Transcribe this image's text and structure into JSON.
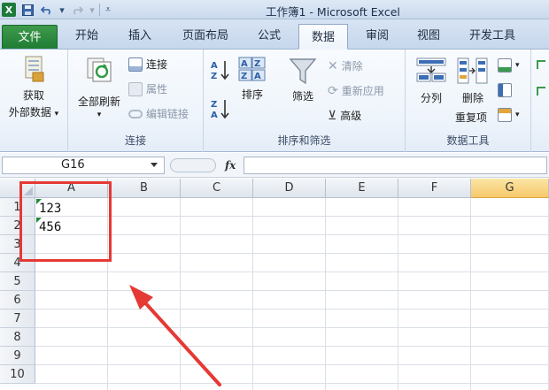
{
  "app": {
    "title": "工作簿1 - Microsoft Excel",
    "logo_letter": "X",
    "qat": {
      "save_icon": "save-icon",
      "undo_icon": "undo-icon",
      "redo_icon": "redo-icon",
      "customize_icon": "customize-qat-icon"
    }
  },
  "tabs": [
    {
      "label": "文件",
      "kind": "file"
    },
    {
      "label": "开始"
    },
    {
      "label": "插入"
    },
    {
      "label": "页面布局"
    },
    {
      "label": "公式"
    },
    {
      "label": "数据",
      "active": true
    },
    {
      "label": "审阅"
    },
    {
      "label": "视图"
    },
    {
      "label": "开发工具"
    }
  ],
  "ribbon": {
    "get_external_line1": "获取",
    "get_external_line2": "外部数据",
    "refresh_all": "全部刷新",
    "connections": "连接",
    "properties": "属性",
    "edit_links": "编辑链接",
    "group_connections": "连接",
    "sort": "排序",
    "filter": "筛选",
    "clear": "清除",
    "reapply": "重新应用",
    "advanced": "高级",
    "group_sort_filter": "排序和筛选",
    "text_to_columns": "分列",
    "remove_dup_line1": "删除",
    "remove_dup_line2": "重复项",
    "group_data_tools": "数据工具"
  },
  "formula_bar": {
    "name_box": "G16",
    "fx": "fx",
    "formula": ""
  },
  "sheet": {
    "columns": [
      "A",
      "B",
      "C",
      "D",
      "E",
      "F",
      "G"
    ],
    "selected_column": "G",
    "rows": [
      "1",
      "2",
      "3",
      "4",
      "5",
      "6",
      "7",
      "8",
      "9",
      "10"
    ],
    "cells": {
      "A1": "123",
      "A2": "456"
    }
  },
  "colors": {
    "file_tab": "#2a8a3e",
    "selection_header": "#f6c96a",
    "annotation_red": "#e53935",
    "error_triangle": "#1d8a3a"
  }
}
